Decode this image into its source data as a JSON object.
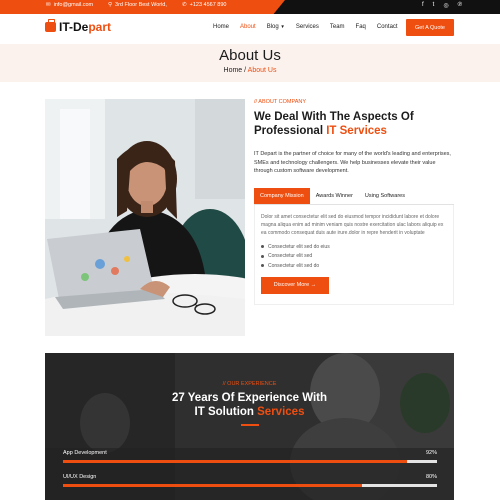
{
  "topbar": {
    "email": "info@gmail.com",
    "address": "3rd Floor Best World,",
    "phone": "+123 4567 890",
    "social": [
      {
        "icon": "facebook-icon",
        "glyph": "f"
      },
      {
        "icon": "twitter-icon",
        "glyph": "t"
      },
      {
        "icon": "instagram-icon",
        "glyph": "◎"
      },
      {
        "icon": "pinterest-icon",
        "glyph": "℗"
      }
    ]
  },
  "nav": {
    "logo_part1": "IT-De",
    "logo_part2": "part",
    "items": [
      "Home",
      "About",
      "Blog",
      "Services",
      "Team",
      "Faq",
      "Contact"
    ],
    "active": "About",
    "dropdown_item": "Blog",
    "cta": "Get A Quote"
  },
  "banner": {
    "title": "About Us",
    "crumb_home": "Home",
    "crumb_sep": " / ",
    "crumb_current": "About Us"
  },
  "about": {
    "tag": "// ABOUT COMPANY",
    "title_line1": "We Deal With The Aspects Of",
    "title_line2_plain": "Professional ",
    "title_line2_accent": "IT Services",
    "description": "IT Depart is the partner of choice for many of the world's leading and enterprises, SMEs and technology challengers. We help businesses elevate their value through custom software development.",
    "tabs": [
      "Company Mission",
      "Awards Winner",
      "Using Softwares"
    ],
    "active_tab": "Company Mission",
    "tab_text": "Dolor sit amet consectetur elit sed do eiusmod tempor incididunt labore et dolore magna aliqua enim ad minim veniam quis nostre exercitation ulac labors aliquip ex ea commodo consequat duis aute irure.dolor in repre henderit in voluptate",
    "bullets": [
      "Consectetur elit sed do eius",
      "Consectetur elit sed",
      "Consectetur elit sed do"
    ],
    "button": "Discover More →"
  },
  "experience": {
    "tag": "// OUR EXPERIENCE",
    "title_line1": "27 Years Of Experience With",
    "title_line2_plain": "IT Solution ",
    "title_line2_accent": "Services",
    "skills": [
      {
        "name": "App Development",
        "percent_label": "92%",
        "value": 0.92
      },
      {
        "name": "UI/UX Design",
        "percent_label": "80%",
        "value": 0.8
      }
    ]
  },
  "colors": {
    "accent": "#ee4e10",
    "dark": "#111111"
  }
}
